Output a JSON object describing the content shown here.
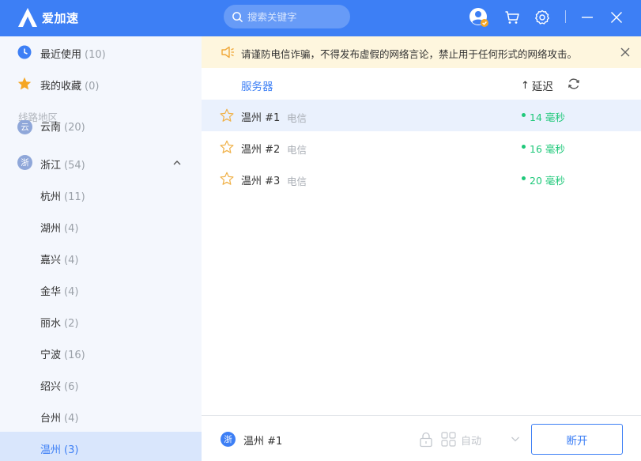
{
  "app": {
    "name": "爱加速"
  },
  "search": {
    "placeholder": "搜索关键字"
  },
  "sidebar": {
    "recent": {
      "label": "最近使用",
      "count": "(10)"
    },
    "favorites": {
      "label": "我的收藏",
      "count": "(0)"
    },
    "section_title": "线路地区",
    "partial_province": {
      "badge": "云",
      "label": "云南",
      "count": "(20)"
    },
    "province": {
      "badge": "浙",
      "label": "浙江",
      "count": "(54)"
    },
    "cities": [
      {
        "label": "杭州",
        "count": "(11)"
      },
      {
        "label": "湖州",
        "count": "(4)"
      },
      {
        "label": "嘉兴",
        "count": "(4)"
      },
      {
        "label": "金华",
        "count": "(4)"
      },
      {
        "label": "丽水",
        "count": "(2)"
      },
      {
        "label": "宁波",
        "count": "(16)"
      },
      {
        "label": "绍兴",
        "count": "(6)"
      },
      {
        "label": "台州",
        "count": "(4)"
      },
      {
        "label": "温州",
        "count": "(3)"
      }
    ]
  },
  "notice": {
    "text": "请谨防电信诈骗，不得发布虚假的网络言论，禁止用于任何形式的网络攻击。"
  },
  "table": {
    "col_server": "服务器",
    "col_latency_arrow": "↑",
    "col_latency": "延迟",
    "rows": [
      {
        "name": "温州 #1",
        "isp": "电信",
        "latency": "14 毫秒"
      },
      {
        "name": "温州 #2",
        "isp": "电信",
        "latency": "16 毫秒"
      },
      {
        "name": "温州 #3",
        "isp": "电信",
        "latency": "20 毫秒"
      }
    ]
  },
  "footer": {
    "badge": "浙",
    "current_server": "温州 #1",
    "mode": "自动",
    "disconnect": "断开"
  },
  "colors": {
    "accent": "#3d7ff5",
    "latency_good": "#1fc87a",
    "notice_bg": "#fef6de",
    "sidebar_bg": "#f4f7fd"
  }
}
